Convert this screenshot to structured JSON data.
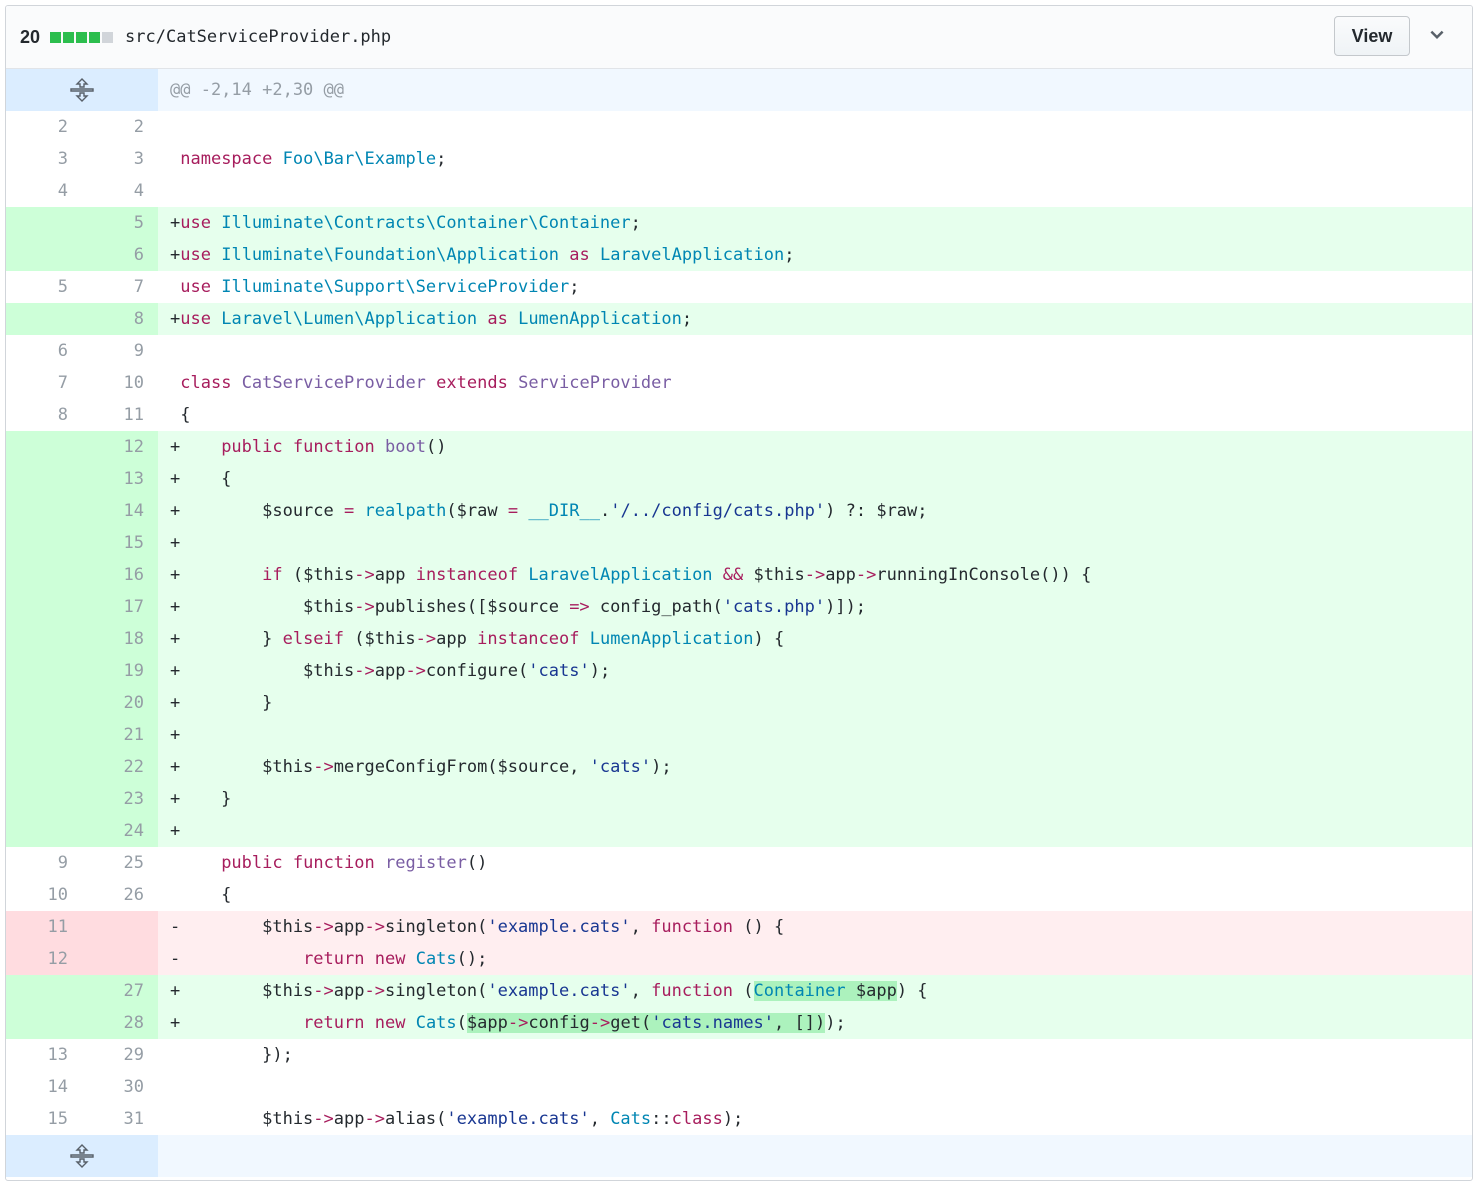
{
  "header": {
    "change_count": "20",
    "diffstat_colors": [
      "#2cbe4e",
      "#2cbe4e",
      "#2cbe4e",
      "#2cbe4e",
      "#d1d5da"
    ],
    "file_path": "src/CatServiceProvider.php",
    "view_button": "View"
  },
  "hunk_header": "@@ -2,14 +2,30 @@",
  "icons": {
    "expand": "unfold-icon",
    "chevron": "chevron-down-icon"
  },
  "lines": [
    {
      "type": "ctx",
      "old": "2",
      "new": "2",
      "code": " "
    },
    {
      "type": "ctx",
      "old": "3",
      "new": "3",
      "code": " namespace Foo\\Bar\\Example;"
    },
    {
      "type": "ctx",
      "old": "4",
      "new": "4",
      "code": " "
    },
    {
      "type": "add",
      "old": "",
      "new": "5",
      "code": "+use Illuminate\\Contracts\\Container\\Container;"
    },
    {
      "type": "add",
      "old": "",
      "new": "6",
      "code": "+use Illuminate\\Foundation\\Application as LaravelApplication;"
    },
    {
      "type": "ctx",
      "old": "5",
      "new": "7",
      "code": " use Illuminate\\Support\\ServiceProvider;"
    },
    {
      "type": "add",
      "old": "",
      "new": "8",
      "code": "+use Laravel\\Lumen\\Application as LumenApplication;"
    },
    {
      "type": "ctx",
      "old": "6",
      "new": "9",
      "code": " "
    },
    {
      "type": "ctx",
      "old": "7",
      "new": "10",
      "code": " class CatServiceProvider extends ServiceProvider"
    },
    {
      "type": "ctx",
      "old": "8",
      "new": "11",
      "code": " {"
    },
    {
      "type": "add",
      "old": "",
      "new": "12",
      "code": "+    public function boot()"
    },
    {
      "type": "add",
      "old": "",
      "new": "13",
      "code": "+    {"
    },
    {
      "type": "add",
      "old": "",
      "new": "14",
      "code": "+        $source = realpath($raw = __DIR__.'/../config/cats.php') ?: $raw;"
    },
    {
      "type": "add",
      "old": "",
      "new": "15",
      "code": "+"
    },
    {
      "type": "add",
      "old": "",
      "new": "16",
      "code": "+        if ($this->app instanceof LaravelApplication && $this->app->runningInConsole()) {"
    },
    {
      "type": "add",
      "old": "",
      "new": "17",
      "code": "+            $this->publishes([$source => config_path('cats.php')]);"
    },
    {
      "type": "add",
      "old": "",
      "new": "18",
      "code": "+        } elseif ($this->app instanceof LumenApplication) {"
    },
    {
      "type": "add",
      "old": "",
      "new": "19",
      "code": "+            $this->app->configure('cats');"
    },
    {
      "type": "add",
      "old": "",
      "new": "20",
      "code": "+        }"
    },
    {
      "type": "add",
      "old": "",
      "new": "21",
      "code": "+"
    },
    {
      "type": "add",
      "old": "",
      "new": "22",
      "code": "+        $this->mergeConfigFrom($source, 'cats');"
    },
    {
      "type": "add",
      "old": "",
      "new": "23",
      "code": "+    }"
    },
    {
      "type": "add",
      "old": "",
      "new": "24",
      "code": "+"
    },
    {
      "type": "ctx",
      "old": "9",
      "new": "25",
      "code": "     public function register()"
    },
    {
      "type": "ctx",
      "old": "10",
      "new": "26",
      "code": "     {"
    },
    {
      "type": "del",
      "old": "11",
      "new": "",
      "code": "-        $this->app->singleton('example.cats', function () {"
    },
    {
      "type": "del",
      "old": "12",
      "new": "",
      "code": "-            return new Cats();"
    },
    {
      "type": "add",
      "old": "",
      "new": "27",
      "code": "+        $this->app->singleton('example.cats', function (Container $app) {"
    },
    {
      "type": "add",
      "old": "",
      "new": "28",
      "code": "+            return new Cats($app->config->get('cats.names', []));"
    },
    {
      "type": "ctx",
      "old": "13",
      "new": "29",
      "code": "         });"
    },
    {
      "type": "ctx",
      "old": "14",
      "new": "30",
      "code": " "
    },
    {
      "type": "ctx",
      "old": "15",
      "new": "31",
      "code": "         $this->app->alias('example.cats', Cats::class);"
    }
  ]
}
